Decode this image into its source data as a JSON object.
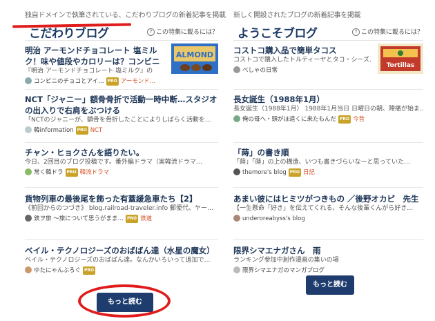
{
  "left": {
    "tagline": "独自ドメインで執筆されている、こだわりブログの新着記事を掲載",
    "title": "こだわりブログ",
    "help": "この特集に載るには？",
    "entries": [
      {
        "title": "明治 アーモンドチョコレート 塩ミルク！味や値段やカロリーは？コンビニで買え…",
        "excerpt": "『明治 アーモンドチョコレート 塩ミルク』の",
        "author": "コンビニのチョコとアイ…",
        "category": "アーモンド…"
      },
      {
        "title": "NCT「ジャニー」額骨骨折で活動一時中断…スタジオの出入りで右肩をぶつける",
        "excerpt": "「NCTのジャニーが、額骨を骨折したことによりしばらく活動を…",
        "author": "韓information",
        "category": "NCT"
      },
      {
        "title": "チャン・ヒョクさんを語りたい。",
        "excerpt": "今日、2回目のブログ投稿です。番外編ドラマ（実韓流ドラマ…",
        "author": "常く韓ドラ",
        "category": "韓流ドラマ"
      },
      {
        "title": "貨物列車の最後尾を飾った有蓋緩急車たち【2】",
        "excerpt": "《前回からのつづき》 blog.railroad-traveler.info 郵便代、ヤー…",
        "author": "鉄ヲ旅 ～旅について思うがまま…",
        "category": "鉄道"
      },
      {
        "title": "ベイル・テクノロジーズのおばばん達（水星の魔女）",
        "excerpt": "ベイル・テクノロジーズのおばばん達。なんかいろいって追加で…",
        "author": "ゆたにゃんぶろぐ",
        "category": ""
      }
    ],
    "more": "もっと読む"
  },
  "right": {
    "tagline": "新しく開設されたブログの新着記事を掲載",
    "title": "ようこそブログ",
    "help": "この特集に載るには？",
    "entries": [
      {
        "title": "コストコ購入品で簡単タコス",
        "excerpt": "コストコで購入したトルティーヤとタコ・シーズ…",
        "author": "べしゃの日常",
        "category": ""
      },
      {
        "title": "長女誕生（1988年1月）",
        "excerpt": "長女誕生（1988年1月） 1988年1月当日 日曜日の朝、陣痛が始ま…",
        "author": "俺の母へ・頭がほ遠くに来たもんだ",
        "category": "今昔"
      },
      {
        "title": "「蒔」の書き順",
        "excerpt": "「蒔」「蒔」の上の構造、いつも書きづらいなーと思っていた…",
        "author": "themore's blog",
        "category": "日記"
      },
      {
        "title": "あまい彼にはヒミツがつきもの ／後野オカピ　先生",
        "excerpt": "【一生懸命「好き」を伝えてくれる、そんな後輩くんがら好き…",
        "author": "underoreabyss's blog",
        "category": ""
      },
      {
        "title": "限界シマエナガさん　雨",
        "excerpt": "ランキング参加中創作漫画の集いの場",
        "author": "限界シマエナガのマンガブログ",
        "category": ""
      }
    ],
    "more": "もっと読む"
  },
  "thumbs": {
    "left_first": {
      "text": "ALMOND",
      "color": "#3a7bd5"
    },
    "right_first": {
      "text": "Tortillas",
      "color": "#c23b2a"
    }
  }
}
